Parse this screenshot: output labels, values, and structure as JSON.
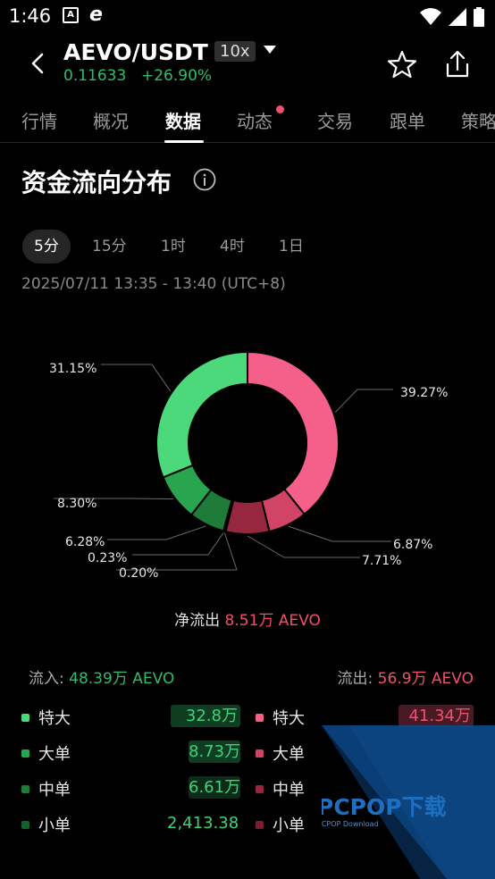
{
  "status_bar": {
    "time": "1:46",
    "left_icons": [
      "a-app-icon",
      "e-app-icon"
    ],
    "right_icons": [
      "wifi-icon",
      "signal-icon",
      "battery-icon"
    ]
  },
  "header": {
    "pair": "AEVO/USDT",
    "leverage": "10x",
    "price": "0.11633",
    "change": "+26.90%",
    "colors": {
      "up": "#2ebd6b",
      "down": "#f0506e"
    }
  },
  "tabs": [
    {
      "label": "行情"
    },
    {
      "label": "概况"
    },
    {
      "label": "数据",
      "active": true
    },
    {
      "label": "动态",
      "dot": true
    },
    {
      "label": "交易"
    },
    {
      "label": "跟单"
    },
    {
      "label": "策略"
    }
  ],
  "section": {
    "title": "资金流向分布"
  },
  "periods": [
    {
      "label": "5分",
      "active": true
    },
    {
      "label": "15分"
    },
    {
      "label": "1时"
    },
    {
      "label": "4时"
    },
    {
      "label": "1日"
    }
  ],
  "time_range": "2025/07/11 13:35 - 13:40 (UTC+8)",
  "chart_data": {
    "type": "pie",
    "subtype": "donut",
    "categories": [
      "流出 特大",
      "流出 大单",
      "流出 中单",
      "流出 小单",
      "流入 小单",
      "流入 中单",
      "流入 大单",
      "流入 特大"
    ],
    "values": [
      39.27,
      6.87,
      7.71,
      0.2,
      0.23,
      6.28,
      8.3,
      31.15
    ],
    "labels": [
      "39.27%",
      "6.87%",
      "7.71%",
      "0.20%",
      "0.23%",
      "6.28%",
      "8.30%",
      "31.15%"
    ],
    "colors": [
      "#f4608a",
      "#d24466",
      "#97263f",
      "#7a1e31",
      "#15612c",
      "#1f7c38",
      "#29a550",
      "#4cd97c"
    ]
  },
  "netflow": {
    "label": "净流出",
    "value": "8.51万 AEVO"
  },
  "inflow": {
    "label": "流入:",
    "value": "48.39万 AEVO"
  },
  "outflow": {
    "label": "流出:",
    "value": "56.9万 AEVO"
  },
  "inflow_rows": [
    {
      "label": "特大",
      "value": "32.8万"
    },
    {
      "label": "大单",
      "value": "8.73万"
    },
    {
      "label": "中单",
      "value": "6.61万"
    },
    {
      "label": "小单",
      "value": "2,413.38"
    }
  ],
  "outflow_rows": [
    {
      "label": "特大",
      "value": "41.34万"
    },
    {
      "label": "大单",
      "value": ""
    },
    {
      "label": "中单",
      "value": ""
    },
    {
      "label": "小单",
      "value": ""
    }
  ],
  "watermark": {
    "brand": "PCPOP下载",
    "sub": "PCPOP Download"
  }
}
